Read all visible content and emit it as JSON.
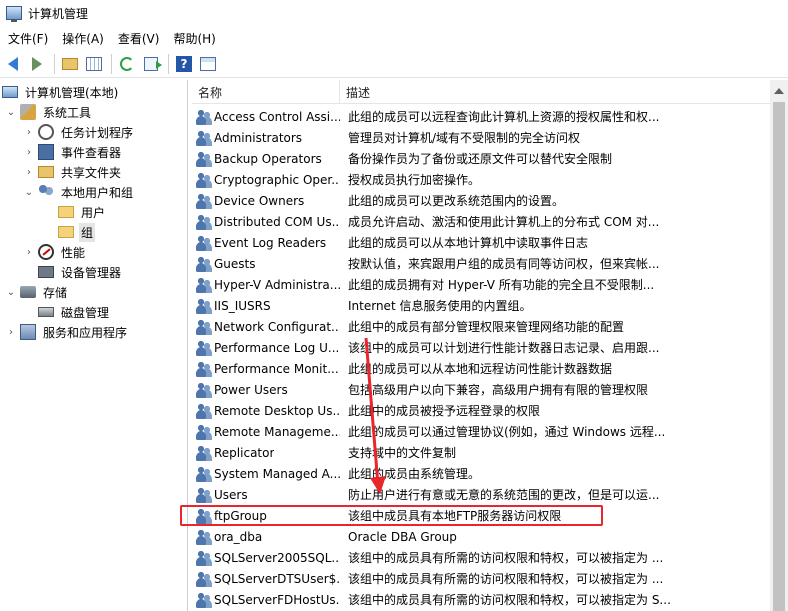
{
  "window": {
    "title": "计算机管理"
  },
  "menu": [
    "文件(F)",
    "操作(A)",
    "查看(V)",
    "帮助(H)"
  ],
  "toolbar": {
    "icons": [
      "back-arrow-icon",
      "forward-arrow-icon",
      "up-folder-icon",
      "show-hide-tree-icon",
      "refresh-icon",
      "export-list-icon",
      "help-icon",
      "view-icon"
    ]
  },
  "tree": [
    {
      "label": "计算机管理(本地)",
      "icon": "computer-icon",
      "level": 0,
      "chevron": ""
    },
    {
      "label": "系统工具",
      "icon": "tools-icon",
      "level": 1,
      "chevron": "expanded"
    },
    {
      "label": "任务计划程序",
      "icon": "clock-icon",
      "level": 2,
      "chevron": "collapsed"
    },
    {
      "label": "事件查看器",
      "icon": "event-viewer-icon",
      "level": 2,
      "chevron": "collapsed"
    },
    {
      "label": "共享文件夹",
      "icon": "shared-folder-icon",
      "level": 2,
      "chevron": "collapsed"
    },
    {
      "label": "本地用户和组",
      "icon": "users-icon",
      "level": 2,
      "chevron": "expanded"
    },
    {
      "label": "用户",
      "icon": "folder-icon",
      "level": 3,
      "chevron": ""
    },
    {
      "label": "组",
      "icon": "folder-icon",
      "level": 3,
      "chevron": "",
      "selected": true
    },
    {
      "label": "性能",
      "icon": "performance-icon",
      "level": 2,
      "chevron": "collapsed"
    },
    {
      "label": "设备管理器",
      "icon": "device-manager-icon",
      "level": 2,
      "chevron": ""
    },
    {
      "label": "存储",
      "icon": "storage-icon",
      "level": 1,
      "chevron": "expanded"
    },
    {
      "label": "磁盘管理",
      "icon": "disk-icon",
      "level": 2,
      "chevron": ""
    },
    {
      "label": "服务和应用程序",
      "icon": "services-icon",
      "level": 1,
      "chevron": "collapsed"
    }
  ],
  "list": {
    "columns": [
      "名称",
      "描述"
    ],
    "rows": [
      {
        "name": "Access Control Assi...",
        "desc": "此组的成员可以远程查询此计算机上资源的授权属性和权..."
      },
      {
        "name": "Administrators",
        "desc": "管理员对计算机/域有不受限制的完全访问权"
      },
      {
        "name": "Backup Operators",
        "desc": "备份操作员为了备份或还原文件可以替代安全限制"
      },
      {
        "name": "Cryptographic Oper...",
        "desc": "授权成员执行加密操作。"
      },
      {
        "name": "Device Owners",
        "desc": "此组的成员可以更改系统范围内的设置。"
      },
      {
        "name": "Distributed COM Us...",
        "desc": "成员允许启动、激活和使用此计算机上的分布式 COM 对..."
      },
      {
        "name": "Event Log Readers",
        "desc": "此组的成员可以从本地计算机中读取事件日志"
      },
      {
        "name": "Guests",
        "desc": "按默认值，来宾跟用户组的成员有同等访问权，但来宾帐..."
      },
      {
        "name": "Hyper-V Administra...",
        "desc": "此组的成员拥有对 Hyper-V 所有功能的完全且不受限制..."
      },
      {
        "name": "IIS_IUSRS",
        "desc": "Internet 信息服务使用的内置组。"
      },
      {
        "name": "Network Configurat...",
        "desc": "此组中的成员有部分管理权限来管理网络功能的配置"
      },
      {
        "name": "Performance Log U...",
        "desc": "该组中的成员可以计划进行性能计数器日志记录、启用跟..."
      },
      {
        "name": "Performance Monit...",
        "desc": "此组的成员可以从本地和远程访问性能计数器数据"
      },
      {
        "name": "Power Users",
        "desc": "包括高级用户以向下兼容，高级用户拥有有限的管理权限"
      },
      {
        "name": "Remote Desktop Us...",
        "desc": "此组中的成员被授予远程登录的权限"
      },
      {
        "name": "Remote Manageme...",
        "desc": "此组的成员可以通过管理协议(例如，通过 Windows 远程..."
      },
      {
        "name": "Replicator",
        "desc": "支持域中的文件复制"
      },
      {
        "name": "System Managed A...",
        "desc": "此组的成员由系统管理。"
      },
      {
        "name": "Users",
        "desc": "防止用户进行有意或无意的系统范围的更改，但是可以运..."
      },
      {
        "name": "ftpGroup",
        "desc": "该组中成员具有本地FTP服务器访问权限",
        "highlighted": true
      },
      {
        "name": "ora_dba",
        "desc": "Oracle DBA Group"
      },
      {
        "name": "SQLServer2005SQL...",
        "desc": "该组中的成员具有所需的访问权限和特权，可以被指定为 ..."
      },
      {
        "name": "SQLServerDTSUser$...",
        "desc": "该组中的成员具有所需的访问权限和特权，可以被指定为 ..."
      },
      {
        "name": "SQLServerFDHostUs...",
        "desc": "该组中的成员具有所需的访问权限和特权，可以被指定为 S..."
      }
    ]
  },
  "annotation": {
    "color": "#e8262c"
  }
}
